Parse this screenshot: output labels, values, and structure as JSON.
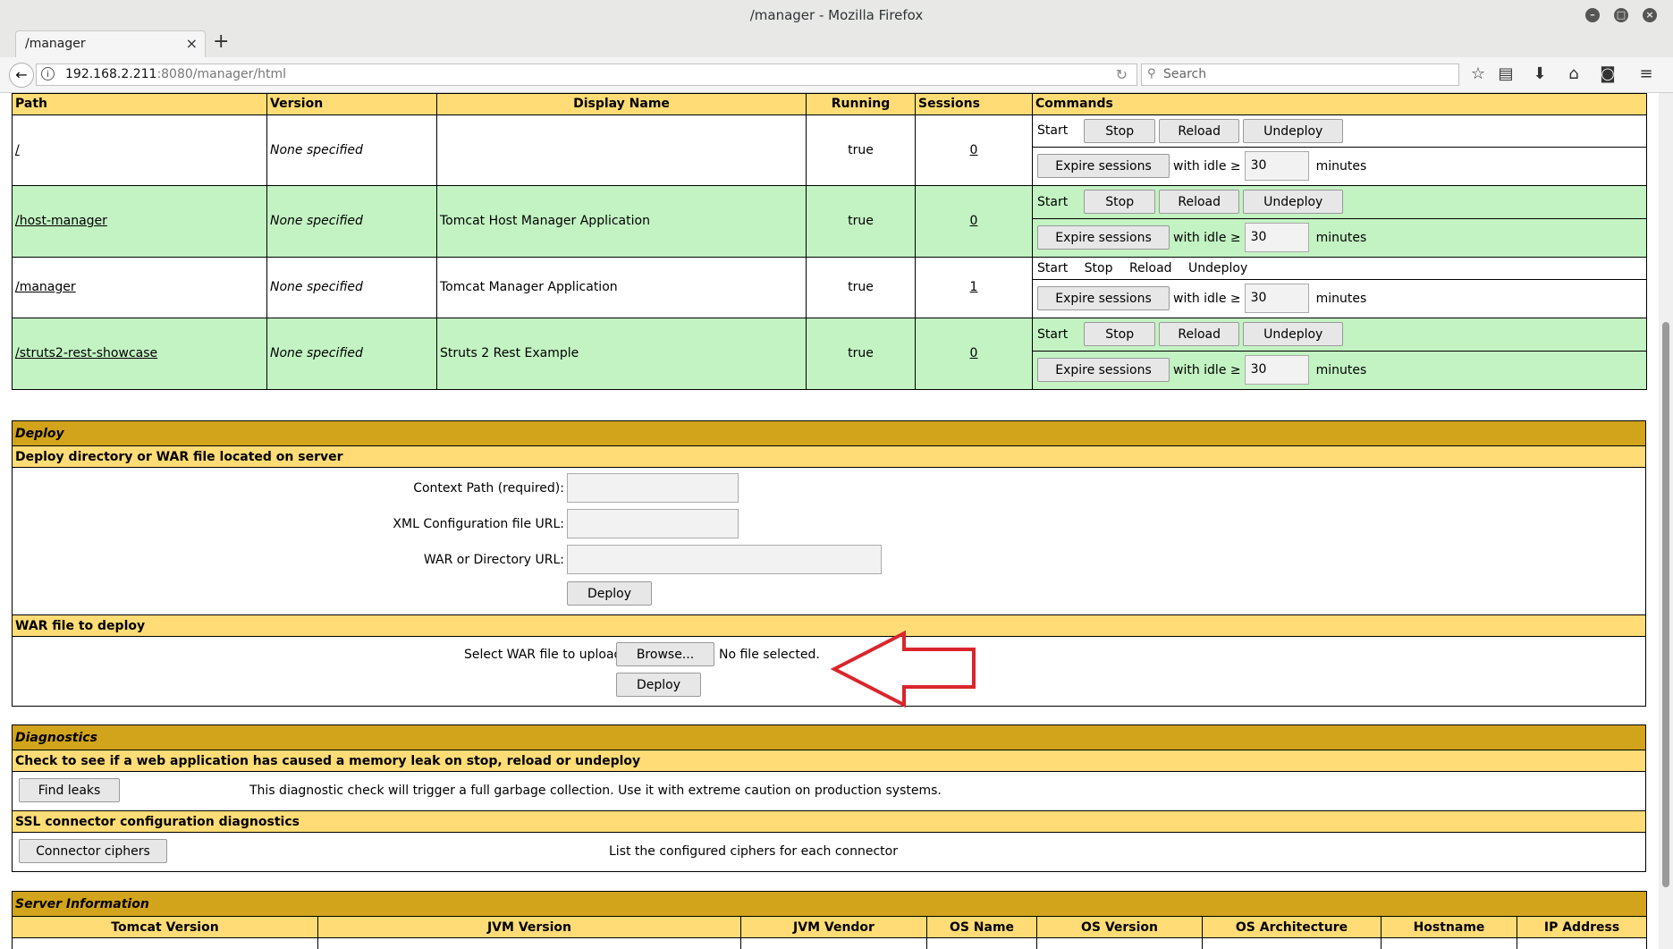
{
  "window": {
    "title": "/manager - Mozilla Firefox"
  },
  "tab": {
    "title": "/manager"
  },
  "nav": {
    "url_host": "192.168.2.211",
    "url_rest": ":8080/manager/html",
    "search_placeholder": "Search"
  },
  "apps": {
    "headers": [
      "Path",
      "Version",
      "Display Name",
      "Running",
      "Sessions",
      "Commands"
    ],
    "rows": [
      {
        "path": "/",
        "version": "None specified",
        "display": "",
        "running": "true",
        "sessions": "0",
        "idle": "30"
      },
      {
        "path": "/host-manager",
        "version": "None specified",
        "display": "Tomcat Host Manager Application",
        "running": "true",
        "sessions": "0",
        "idle": "30"
      },
      {
        "path": "/manager",
        "version": "None specified",
        "display": "Tomcat Manager Application",
        "running": "true",
        "sessions": "1",
        "idle": "30"
      },
      {
        "path": "/struts2-rest-showcase",
        "version": "None specified",
        "display": "Struts 2 Rest Example",
        "running": "true",
        "sessions": "0",
        "idle": "30"
      }
    ],
    "cmd": {
      "start": "Start",
      "stop": "Stop",
      "reload": "Reload",
      "undeploy": "Undeploy",
      "expire": "Expire sessions",
      "with_idle": "with idle ≥",
      "minutes": "minutes"
    }
  },
  "deploy": {
    "title": "Deploy",
    "server_sub": "Deploy directory or WAR file located on server",
    "context_label": "Context Path (required):",
    "xml_label": "XML Configuration file URL:",
    "war_label": "WAR or Directory URL:",
    "deploy_btn": "Deploy",
    "war_sub": "WAR file to deploy",
    "select_label": "Select WAR file to upload",
    "browse_btn": "Browse...",
    "no_file": "No file selected.",
    "deploy_btn2": "Deploy"
  },
  "diagnostics": {
    "title": "Diagnostics",
    "leak_sub": "Check to see if a web application has caused a memory leak on stop, reload or undeploy",
    "find_leaks_btn": "Find leaks",
    "leak_desc": "This diagnostic check will trigger a full garbage collection. Use it with extreme caution on production systems.",
    "ssl_sub": "SSL connector configuration diagnostics",
    "ciphers_btn": "Connector ciphers",
    "ciphers_desc": "List the configured ciphers for each connector"
  },
  "server": {
    "title": "Server Information",
    "headers": [
      "Tomcat Version",
      "JVM Version",
      "JVM Vendor",
      "OS Name",
      "OS Version",
      "OS Architecture",
      "Hostname",
      "IP Address"
    ]
  },
  "annotation": {
    "arrow_color": "#d9262c"
  },
  "colors": {
    "header": "#ffdc75",
    "title": "#d2a41c",
    "green_row": "#c3f3c3"
  }
}
